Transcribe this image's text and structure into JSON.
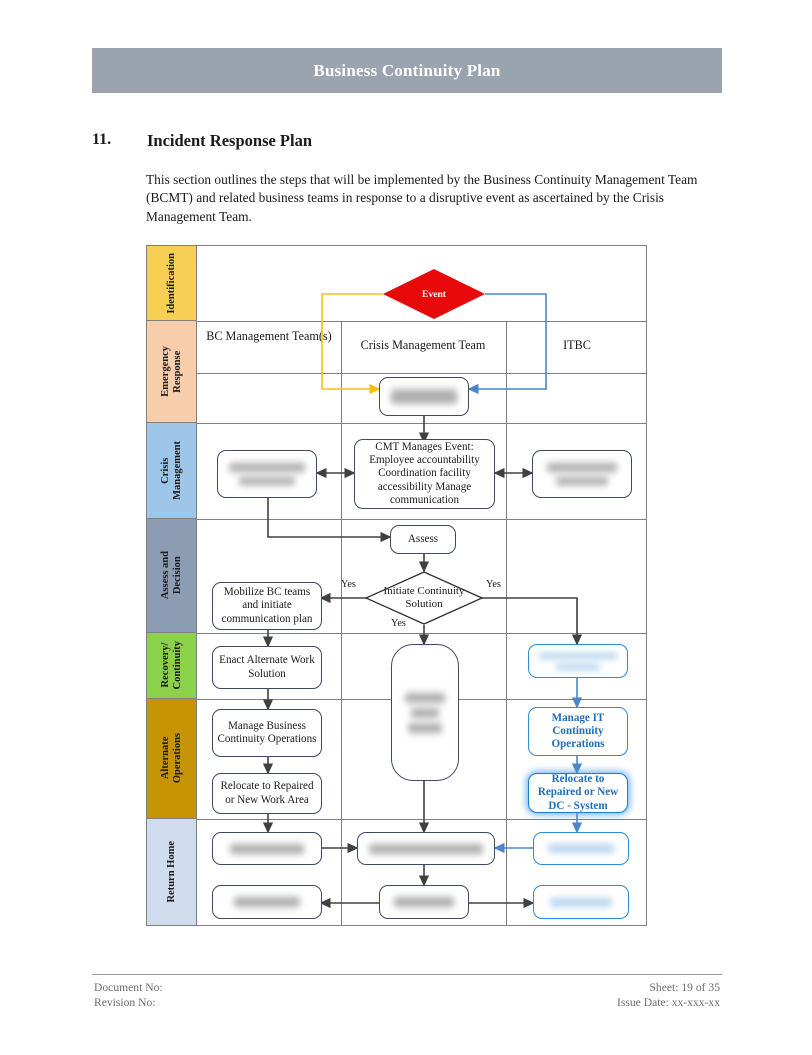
{
  "header": {
    "title": "Business Continuity Plan"
  },
  "section": {
    "number": "11.",
    "title": "Incident Response Plan",
    "intro": "This section outlines the steps that will be implemented by the Business Continuity Management Team (BCMT) and related business teams in response to a disruptive event as ascertained by the Crisis Management Team."
  },
  "diagram": {
    "lanes": [
      {
        "label": "Identification",
        "color": "#f8cf55"
      },
      {
        "label": "Emergency\nResponse",
        "color": "#f7cdab"
      },
      {
        "label": "Crisis\nManagement",
        "color": "#9dc6e8"
      },
      {
        "label": "Assess and\nDecision",
        "color": "#8b9cb3"
      },
      {
        "label": "Recovery/\nContinuity",
        "color": "#8bd14a"
      },
      {
        "label": "Alternate\nOperations",
        "color": "#c79406"
      },
      {
        "label": "Return Home",
        "color": "#cfdcee"
      }
    ],
    "columns": [
      {
        "label": "BC Management Team(s)"
      },
      {
        "label": "Crisis Management Team"
      },
      {
        "label": "ITBC"
      }
    ],
    "event": {
      "label": "Event",
      "color": "#e8090b"
    },
    "nodes": {
      "emergency_cmt": {
        "label": "",
        "redacted": true
      },
      "crisis_bc": {
        "label": "",
        "redacted": true
      },
      "crisis_cmt": {
        "label": "CMT Manages Event: Employee accountability Coordination facility accessibility Manage communication",
        "redacted": false
      },
      "crisis_itbc": {
        "label": "",
        "redacted": true
      },
      "assess": {
        "label": "Assess",
        "redacted": false
      },
      "decision": {
        "label": "Initiate Continuity Solution",
        "redacted": false
      },
      "mobilize": {
        "label": "Mobilize BC teams and initiate communication plan",
        "redacted": false
      },
      "enact": {
        "label": "Enact Alternate Work Solution",
        "redacted": false
      },
      "manage_bc": {
        "label": "Manage Business Continuity Operations",
        "redacted": false
      },
      "relocate_bc": {
        "label": "Relocate to Repaired or New Work Area",
        "redacted": false
      },
      "center_tall": {
        "label": "",
        "redacted": true
      },
      "itbc_recovery": {
        "label": "",
        "redacted": true
      },
      "manage_it": {
        "label": "Manage IT Continuity Operations",
        "redacted": false
      },
      "relocate_it": {
        "label": "Relocate to Repaired or New DC - System",
        "redacted": false
      },
      "rh_bc1": {
        "label": "",
        "redacted": true
      },
      "rh_cmt1": {
        "label": "",
        "redacted": true
      },
      "rh_itbc1": {
        "label": "",
        "redacted": true
      },
      "rh_bc2": {
        "label": "",
        "redacted": true
      },
      "rh_cmt2": {
        "label": "",
        "redacted": true
      },
      "rh_itbc2": {
        "label": "",
        "redacted": true
      }
    },
    "edge_labels": {
      "yes_left": "Yes",
      "yes_right": "Yes",
      "yes_down": "Yes"
    },
    "colors": {
      "yellow_wire": "#f6c10d",
      "blue_wire": "#4a86c8",
      "dark_wire": "#404040",
      "node_border": "#3c4a66",
      "blue_border": "#2e8bd6"
    }
  },
  "footer": {
    "document_no": "Document No:",
    "revision_no": "Revision No:",
    "sheet": "Sheet: 19 of 35",
    "issue_date": "Issue Date: xx-xxx-xx"
  }
}
